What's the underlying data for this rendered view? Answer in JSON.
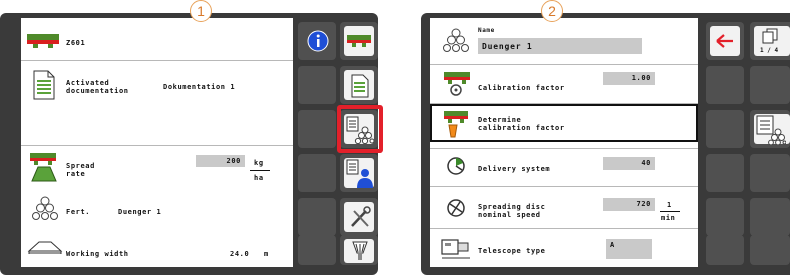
{
  "callouts": [
    "1",
    "2"
  ],
  "screen1": {
    "header": {
      "title": "Z601"
    },
    "rows": [
      {
        "label_line1": "Activated",
        "label_line2": "documentation",
        "value": "Dokumentation 1",
        "icon": "document-icon"
      },
      {
        "label_line1": "Spread",
        "label_line2": "rate",
        "value": "200",
        "unit_top": "kg",
        "unit_bottom": "ha",
        "icon": "spreader-rate-icon"
      },
      {
        "label": "Fert.",
        "value": "Duenger 1",
        "icon": "fertilizer-icon"
      },
      {
        "label": "Working width",
        "value": "24.0",
        "unit": "m",
        "icon": "working-width-icon"
      }
    ],
    "softkeys": [
      "info-icon",
      "spreader-icon",
      "document-icon",
      "fertilizer-database-icon",
      "user-database-icon",
      "tools-icon",
      "machine-icon"
    ],
    "highlight_color": "#e3202a"
  },
  "screen2": {
    "name_label": "Name",
    "name_value": "Duenger 1",
    "rows": [
      {
        "label": "Calibration factor",
        "value": "1.00",
        "icon": "calibration-icon"
      },
      {
        "label_line1": "Determine",
        "label_line2": "calibration factor",
        "icon": "calibration-test-icon"
      },
      {
        "label": "Delivery system",
        "value": "40",
        "icon": "delivery-system-icon"
      },
      {
        "label_line1": "Spreading disc",
        "label_line2": "nominal speed",
        "value": "720",
        "unit_top": "1",
        "unit_bottom": "min",
        "icon": "disc-speed-icon"
      },
      {
        "label": "Telescope type",
        "value": "A",
        "icon": "telescope-icon"
      }
    ],
    "page_indicator": "1 / 4",
    "softkeys": [
      "back-arrow-icon",
      "pages-icon",
      "fertilizer-list-icon"
    ],
    "accent": "#e3202a"
  }
}
